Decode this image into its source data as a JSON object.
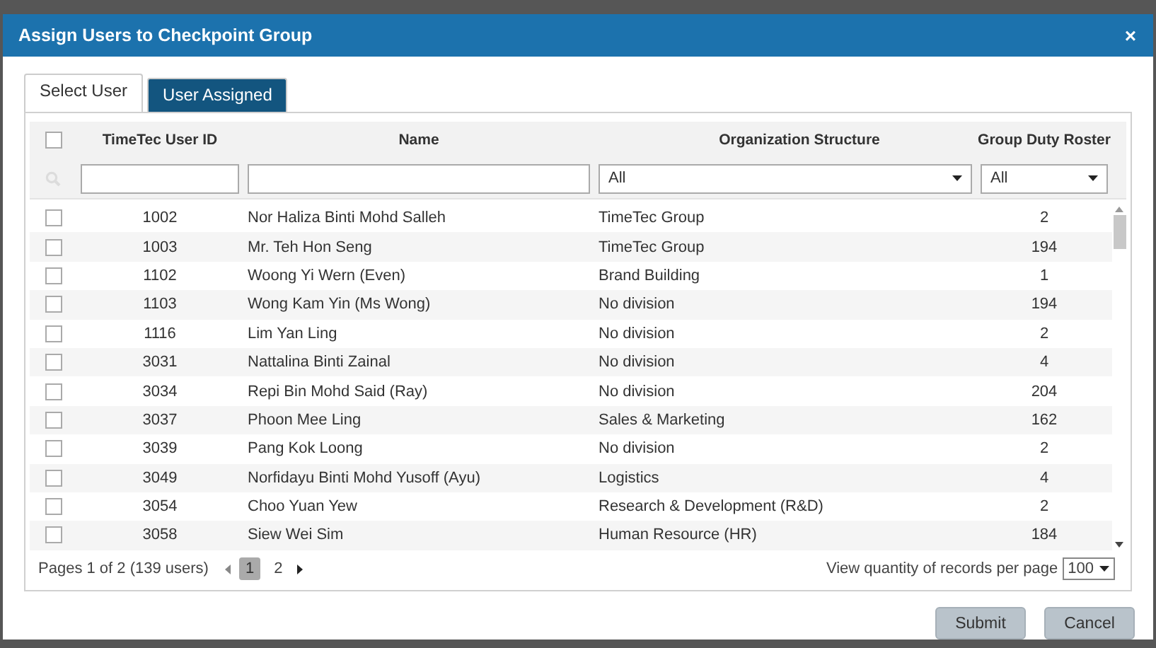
{
  "dialog": {
    "title": "Assign Users to Checkpoint Group",
    "close": "×"
  },
  "tabs": [
    {
      "label": "Select User",
      "selected": true
    },
    {
      "label": "User Assigned",
      "selected": false
    }
  ],
  "table": {
    "all_checked": false,
    "columns": [
      "TimeTec User ID",
      "Name",
      "Organization Structure",
      "Group Duty Roster"
    ],
    "filters": [
      {
        "kind": "text"
      },
      {
        "kind": "text"
      },
      {
        "kind": "select",
        "value": "All"
      },
      {
        "kind": "select",
        "value": "All"
      }
    ],
    "rows": [
      {
        "checked": false,
        "id": "1002",
        "name": "Nor Haliza Binti Mohd Salleh",
        "org": "TimeTec Group",
        "roster": "2"
      },
      {
        "checked": false,
        "id": "1003",
        "name": "Mr. Teh Hon Seng",
        "org": "TimeTec Group",
        "roster": "194"
      },
      {
        "checked": false,
        "id": "1102",
        "name": "Woong Yi Wern (Even)",
        "org": "Brand Building",
        "roster": "1"
      },
      {
        "checked": false,
        "id": "1103",
        "name": "Wong Kam Yin (Ms Wong)",
        "org": "No division",
        "roster": "194"
      },
      {
        "checked": false,
        "id": "1116",
        "name": "Lim Yan Ling",
        "org": "No division",
        "roster": "2"
      },
      {
        "checked": false,
        "id": "3031",
        "name": "Nattalina Binti Zainal",
        "org": "No division",
        "roster": "4"
      },
      {
        "checked": false,
        "id": "3034",
        "name": "Repi Bin Mohd Said (Ray)",
        "org": "No division",
        "roster": "204"
      },
      {
        "checked": false,
        "id": "3037",
        "name": "Phoon Mee Ling",
        "org": "Sales & Marketing",
        "roster": "162"
      },
      {
        "checked": false,
        "id": "3039",
        "name": "Pang Kok Loong",
        "org": "No division",
        "roster": "2"
      },
      {
        "checked": false,
        "id": "3049",
        "name": "Norfidayu Binti Mohd Yusoff (Ayu)",
        "org": "Logistics",
        "roster": "4"
      },
      {
        "checked": false,
        "id": "3054",
        "name": "Choo Yuan Yew",
        "org": "Research & Development (R&D)",
        "roster": "2"
      },
      {
        "checked": false,
        "id": "3058",
        "name": "Siew Wei Sim",
        "org": "Human Resource (HR)",
        "roster": "184"
      }
    ]
  },
  "pagination": {
    "summary": "Pages 1 of 2 (139 users)",
    "pages": [
      {
        "label": "1",
        "selected": true
      },
      {
        "label": "2",
        "selected": false
      }
    ],
    "per_page_label": "View quantity of records per page",
    "per_page": "100"
  },
  "buttons": [
    "Submit",
    "Cancel"
  ]
}
